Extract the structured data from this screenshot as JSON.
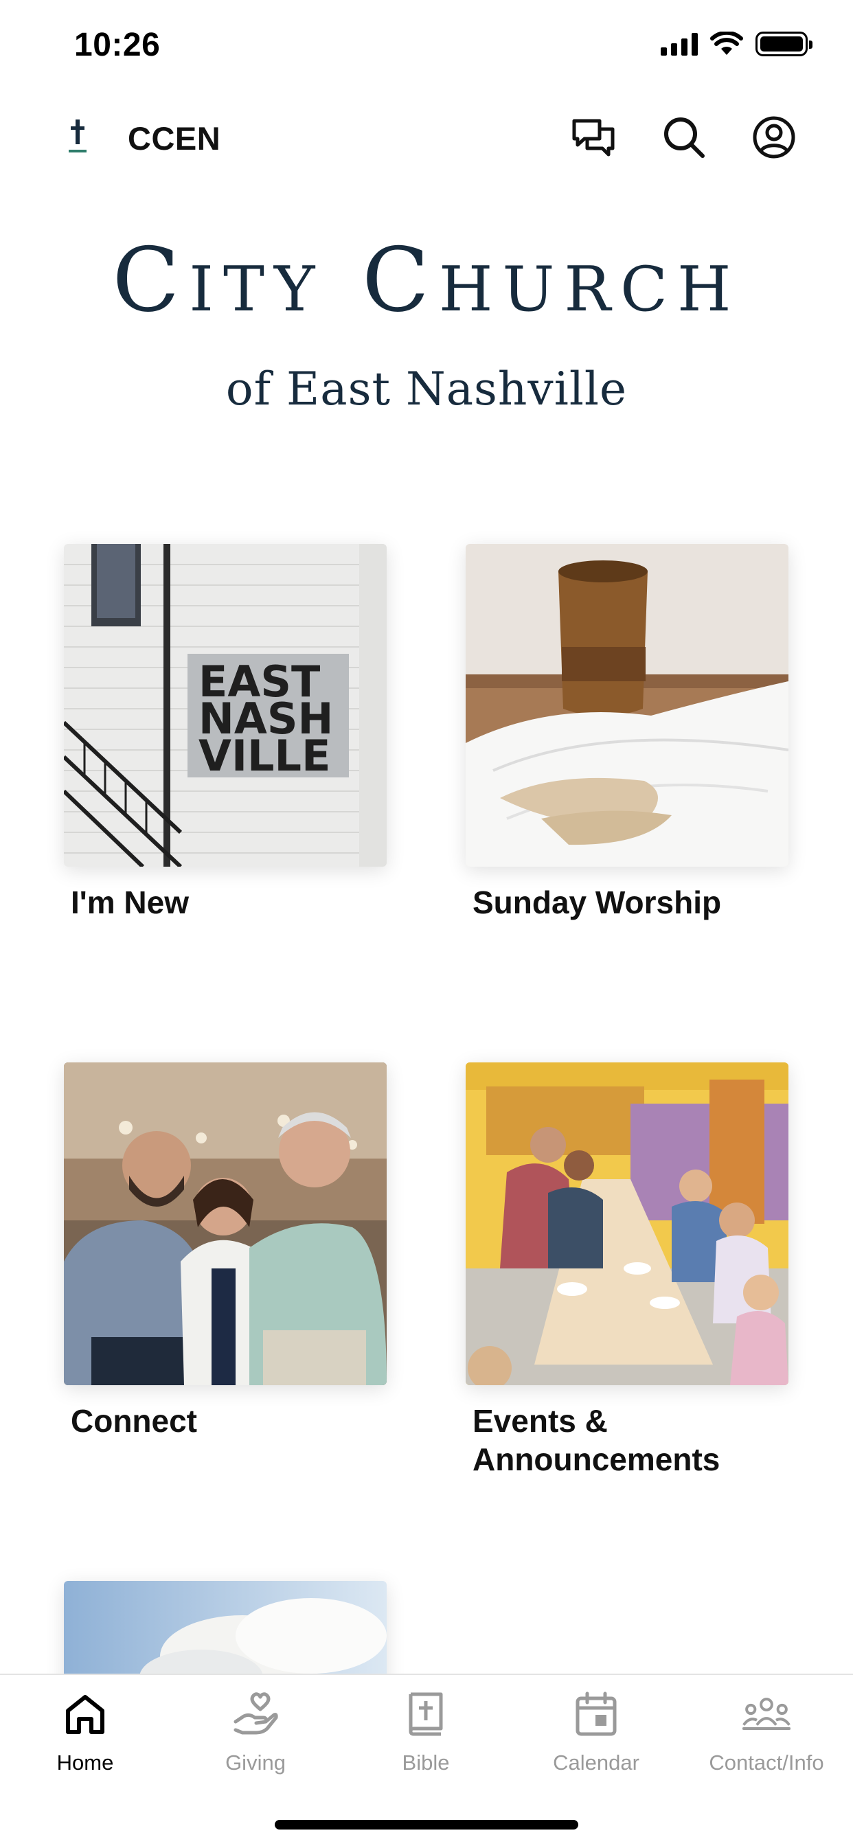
{
  "status_bar": {
    "time": "10:26"
  },
  "header": {
    "brand": "CCEN",
    "accent_color": "#2e7d6b"
  },
  "logo": {
    "title": "City Church",
    "subtitle": "of East Nashville",
    "color": "#172b3d"
  },
  "tiles": [
    {
      "label": "I'm New",
      "image": "east-nashville-wall-mural"
    },
    {
      "label": "Sunday Worship",
      "image": "communion-cup-and-bread"
    },
    {
      "label": "Connect",
      "image": "three-people-smiling"
    },
    {
      "label": "Events &\nAnnouncements",
      "image": "community-dinner-table"
    },
    {
      "label": "",
      "image": "sky-with-clouds"
    }
  ],
  "tab_bar": {
    "active": "Home",
    "tabs": [
      {
        "label": "Home",
        "icon": "home-icon"
      },
      {
        "label": "Giving",
        "icon": "giving-hand-heart-icon"
      },
      {
        "label": "Bible",
        "icon": "bible-icon"
      },
      {
        "label": "Calendar",
        "icon": "calendar-icon"
      },
      {
        "label": "Contact/Info",
        "icon": "people-group-icon"
      }
    ]
  }
}
